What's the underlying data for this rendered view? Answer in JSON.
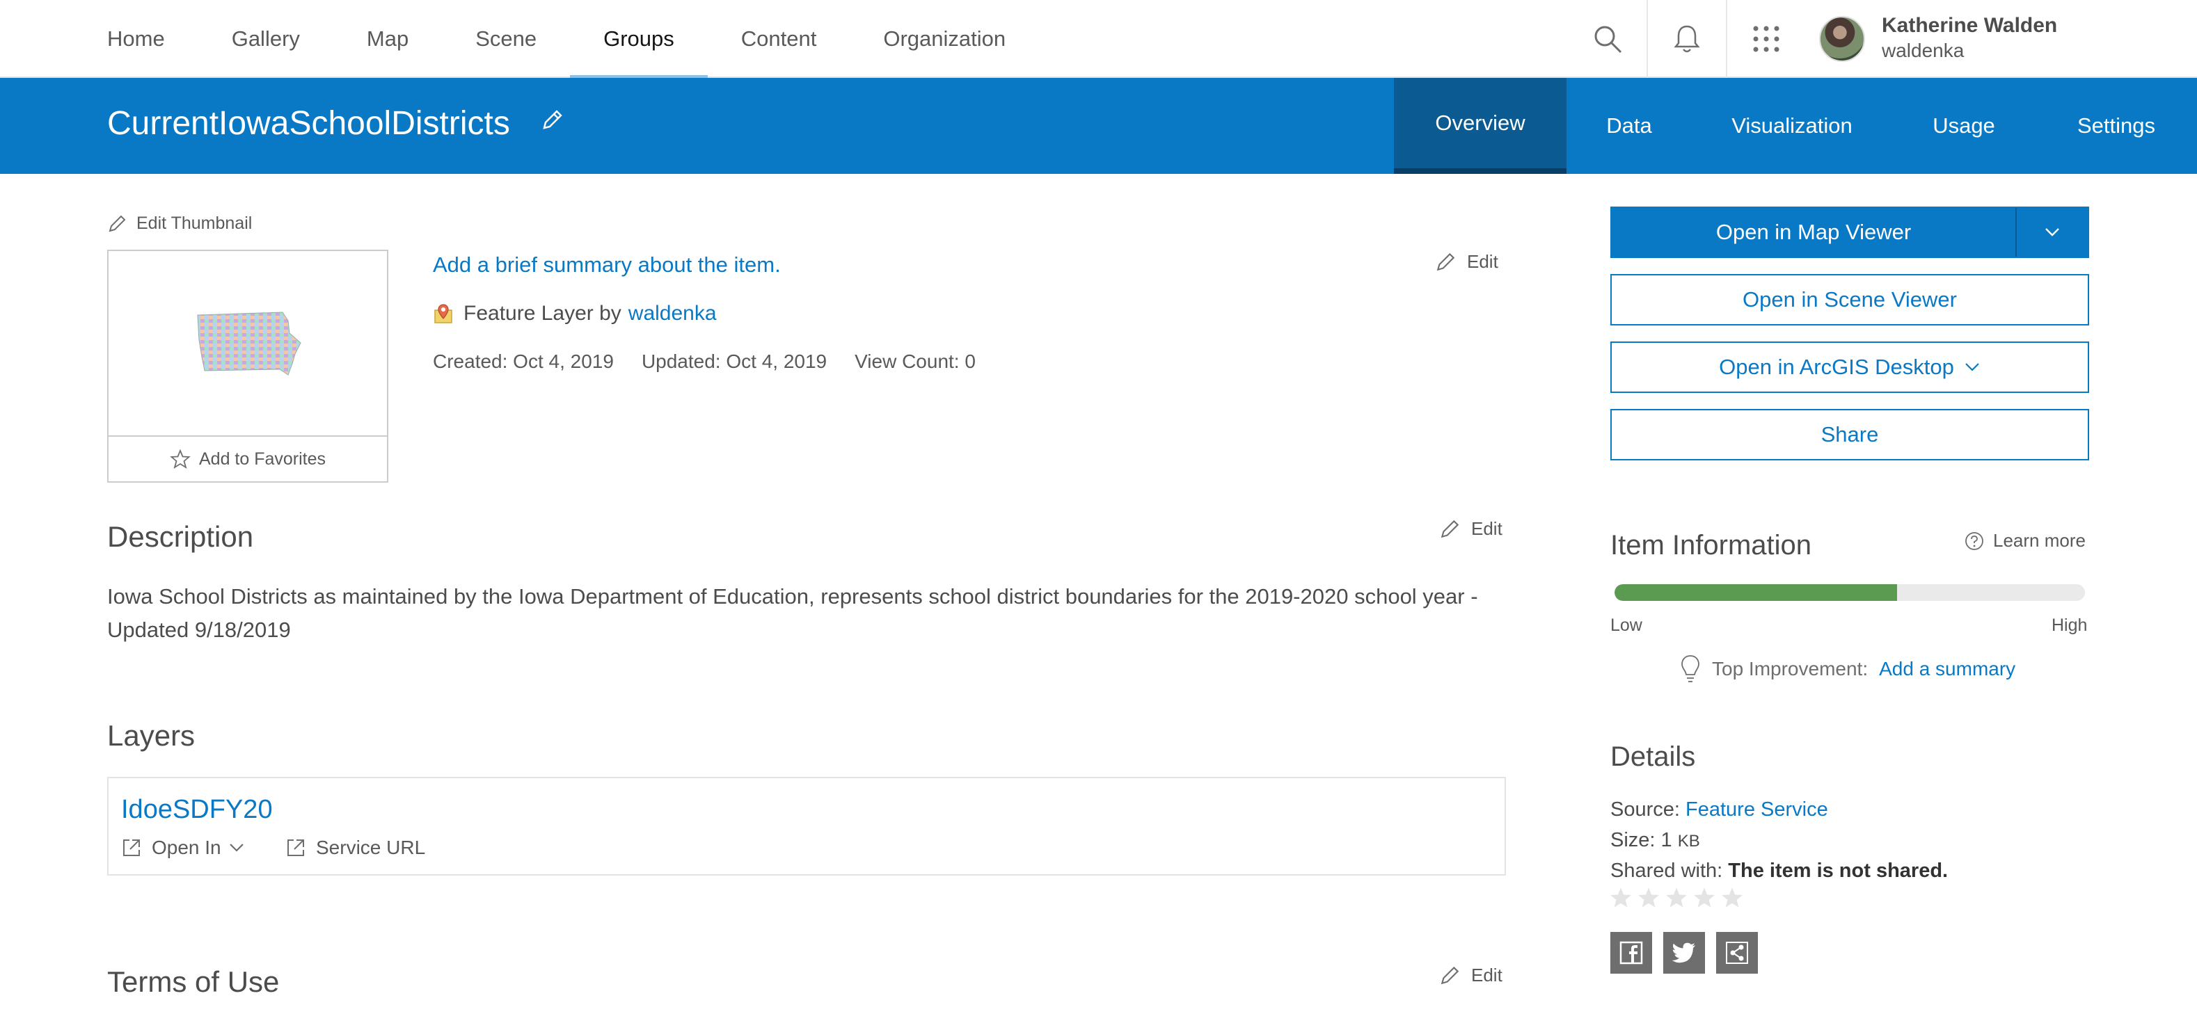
{
  "nav": {
    "links": [
      "Home",
      "Gallery",
      "Map",
      "Scene",
      "Groups",
      "Content",
      "Organization"
    ],
    "active": "Groups",
    "icons": [
      "search-icon",
      "bell-icon",
      "apps-grid-icon"
    ]
  },
  "user": {
    "name": "Katherine Walden",
    "username": "waldenka"
  },
  "header": {
    "title": "CurrentIowaSchoolDistricts",
    "tabs": [
      "Overview",
      "Data",
      "Visualization",
      "Usage",
      "Settings"
    ],
    "active_tab": "Overview"
  },
  "item": {
    "edit_thumbnail": "Edit Thumbnail",
    "add_favorites": "Add to Favorites",
    "summary_link": "Add a brief summary about the item.",
    "edit_label": "Edit",
    "type_text": "Feature Layer by",
    "owner": "waldenka",
    "created": "Created: Oct 4, 2019",
    "updated": "Updated: Oct 4, 2019",
    "view_count": "View Count: 0"
  },
  "description": {
    "heading": "Description",
    "edit_label": "Edit",
    "text": "Iowa School Districts as maintained by the Iowa Department of Education, represents school district boundaries for the 2019-2020 school year - Updated 9/18/2019"
  },
  "layers": {
    "heading": "Layers",
    "items": [
      {
        "name": "IdoeSDFY20",
        "open_in": "Open In",
        "service_url": "Service URL"
      }
    ]
  },
  "terms": {
    "heading": "Terms of Use",
    "edit_label": "Edit"
  },
  "actions": {
    "open_map_viewer": "Open in Map Viewer",
    "open_scene_viewer": "Open in Scene Viewer",
    "open_arcgis_desktop": "Open in ArcGIS Desktop",
    "share": "Share"
  },
  "item_info": {
    "heading": "Item Information",
    "learn_more": "Learn more",
    "score_fraction": 0.6,
    "low_label": "Low",
    "high_label": "High",
    "improvement_label": "Top Improvement:",
    "improvement_link": "Add a summary"
  },
  "details": {
    "heading": "Details",
    "source_label": "Source:",
    "source_value": "Feature Service",
    "size_label": "Size:",
    "size_value": "1",
    "size_unit": "KB",
    "shared_label": "Shared with:",
    "shared_value": "The item is not shared.",
    "rating_stars": 0,
    "social": [
      "facebook-icon",
      "twitter-icon",
      "share-icon"
    ]
  },
  "colors": {
    "brand_blue": "#0a79c5",
    "active_tab": "#0b5a92",
    "meter_fill": "#5a9a51",
    "nav_underline": "#8fbfe3"
  }
}
